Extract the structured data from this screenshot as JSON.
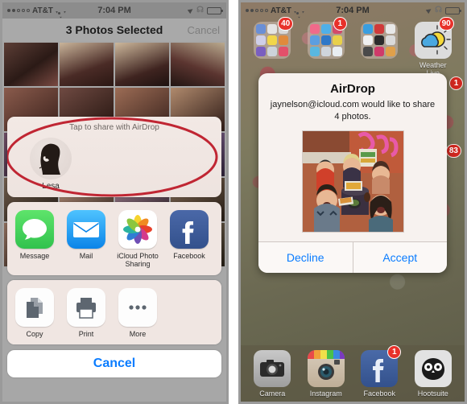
{
  "left_phone": {
    "status_bar": {
      "signal_dots_filled": 2,
      "signal_dots_total": 5,
      "carrier": "AT&T",
      "wifi_icon": "wifi-icon",
      "time": "7:04 PM",
      "location_icon": "location-arrow-icon",
      "bluetooth_icon": "bluetooth-icon",
      "battery_icon": "battery-icon",
      "battery_level_pct": 72
    },
    "nav": {
      "title": "3 Photos Selected",
      "cancel_label": "Cancel"
    },
    "airdrop": {
      "hint": "Tap to share with AirDrop",
      "contacts": [
        {
          "name": "Lesa",
          "avatar_icon": "contact-avatar"
        }
      ],
      "annotation": "red-ellipse-highlight",
      "annotation_color": "#c02633"
    },
    "share_apps": [
      {
        "label": "Message",
        "icon": "message-icon",
        "color": "#4cd964"
      },
      {
        "label": "Mail",
        "icon": "mail-icon",
        "color": "#1d9bf5"
      },
      {
        "label": "iCloud Photo Sharing",
        "icon": "icloud-photo-sharing-icon",
        "color": "#ffffff"
      },
      {
        "label": "Facebook",
        "icon": "facebook-icon",
        "color": "#3b5998"
      },
      {
        "label": "",
        "icon": "twitter-icon",
        "color": "#4099ff"
      }
    ],
    "actions": [
      {
        "label": "Copy",
        "icon": "copy-icon"
      },
      {
        "label": "Print",
        "icon": "print-icon"
      },
      {
        "label": "More",
        "icon": "more-dots-icon"
      }
    ],
    "cancel_button": {
      "label": "Cancel",
      "color": "#0a7cff"
    }
  },
  "right_phone": {
    "status_bar": {
      "signal_dots_filled": 2,
      "signal_dots_total": 5,
      "carrier": "AT&T",
      "wifi_icon": "wifi-icon",
      "time": "7:04 PM",
      "location_icon": "location-arrow-icon",
      "bluetooth_icon": "bluetooth-icon",
      "battery_icon": "battery-icon",
      "battery_level_pct": 72
    },
    "home_apps": [
      {
        "label": "",
        "type": "folder",
        "badge": "40"
      },
      {
        "label": "",
        "type": "folder",
        "badge": "1"
      },
      {
        "label": "",
        "type": "folder",
        "badge": ""
      },
      {
        "label": "Weather Live",
        "type": "app",
        "icon": "weather-live-icon",
        "badge": "90"
      }
    ],
    "side_badges": [
      {
        "value": "1"
      },
      {
        "value": "83"
      }
    ],
    "alert": {
      "title": "AirDrop",
      "message": "jaynelson@icloud.com would like to share 4 photos.",
      "photo_alt": "group-photo-preview",
      "decline_label": "Decline",
      "accept_label": "Accept",
      "button_color": "#0a7cff"
    },
    "dock": [
      {
        "label": "Camera",
        "icon": "camera-icon",
        "badge": ""
      },
      {
        "label": "Instagram",
        "icon": "instagram-icon",
        "badge": ""
      },
      {
        "label": "Facebook",
        "icon": "facebook-icon",
        "badge": "1"
      },
      {
        "label": "Hootsuite",
        "icon": "hootsuite-owl-icon",
        "badge": ""
      }
    ]
  }
}
